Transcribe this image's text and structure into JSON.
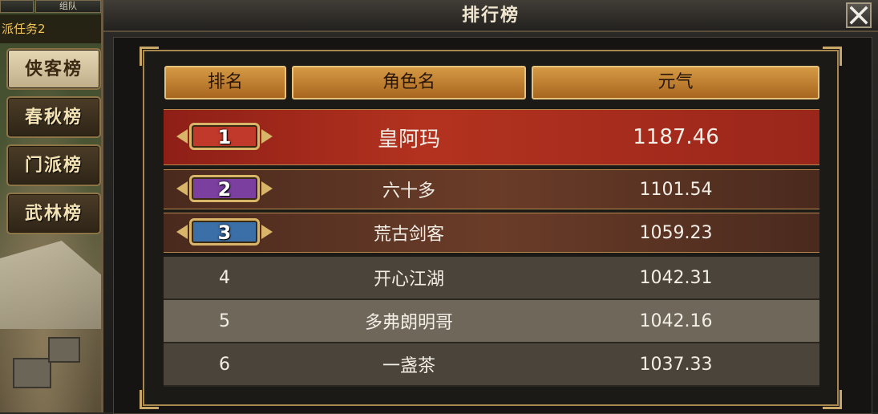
{
  "scene": {
    "top_tabs": [
      "",
      "组队"
    ],
    "quest_text": "派任务2",
    "side_tabs": [
      {
        "label": "侠客榜",
        "active": true
      },
      {
        "label": "春秋榜",
        "active": false
      },
      {
        "label": "门派榜",
        "active": false
      },
      {
        "label": "武林榜",
        "active": false
      }
    ]
  },
  "window": {
    "title": "排行榜",
    "close_icon": "close-x-icon"
  },
  "table": {
    "headers": [
      "排名",
      "角色名",
      "元气"
    ],
    "rows": [
      {
        "rank": "1",
        "name": "皇阿玛",
        "value": "1187.46",
        "badge_color": "#c0392b"
      },
      {
        "rank": "2",
        "name": "六十多",
        "value": "1101.54",
        "badge_color": "#7b3fa0"
      },
      {
        "rank": "3",
        "name": "荒古剑客",
        "value": "1059.23",
        "badge_color": "#3b6fa8"
      },
      {
        "rank": "4",
        "name": "开心江湖",
        "value": "1042.31"
      },
      {
        "rank": "5",
        "name": "多弗朗明哥",
        "value": "1042.16"
      },
      {
        "rank": "6",
        "name": "一盏茶",
        "value": "1037.33"
      }
    ]
  },
  "colors": {
    "header_gold": "#d59a45",
    "row1_red": "#a3261c",
    "row_top_brown": "#5a3424",
    "row_plain_dark": "#4a443b",
    "row_plain_light": "#6e675a"
  }
}
